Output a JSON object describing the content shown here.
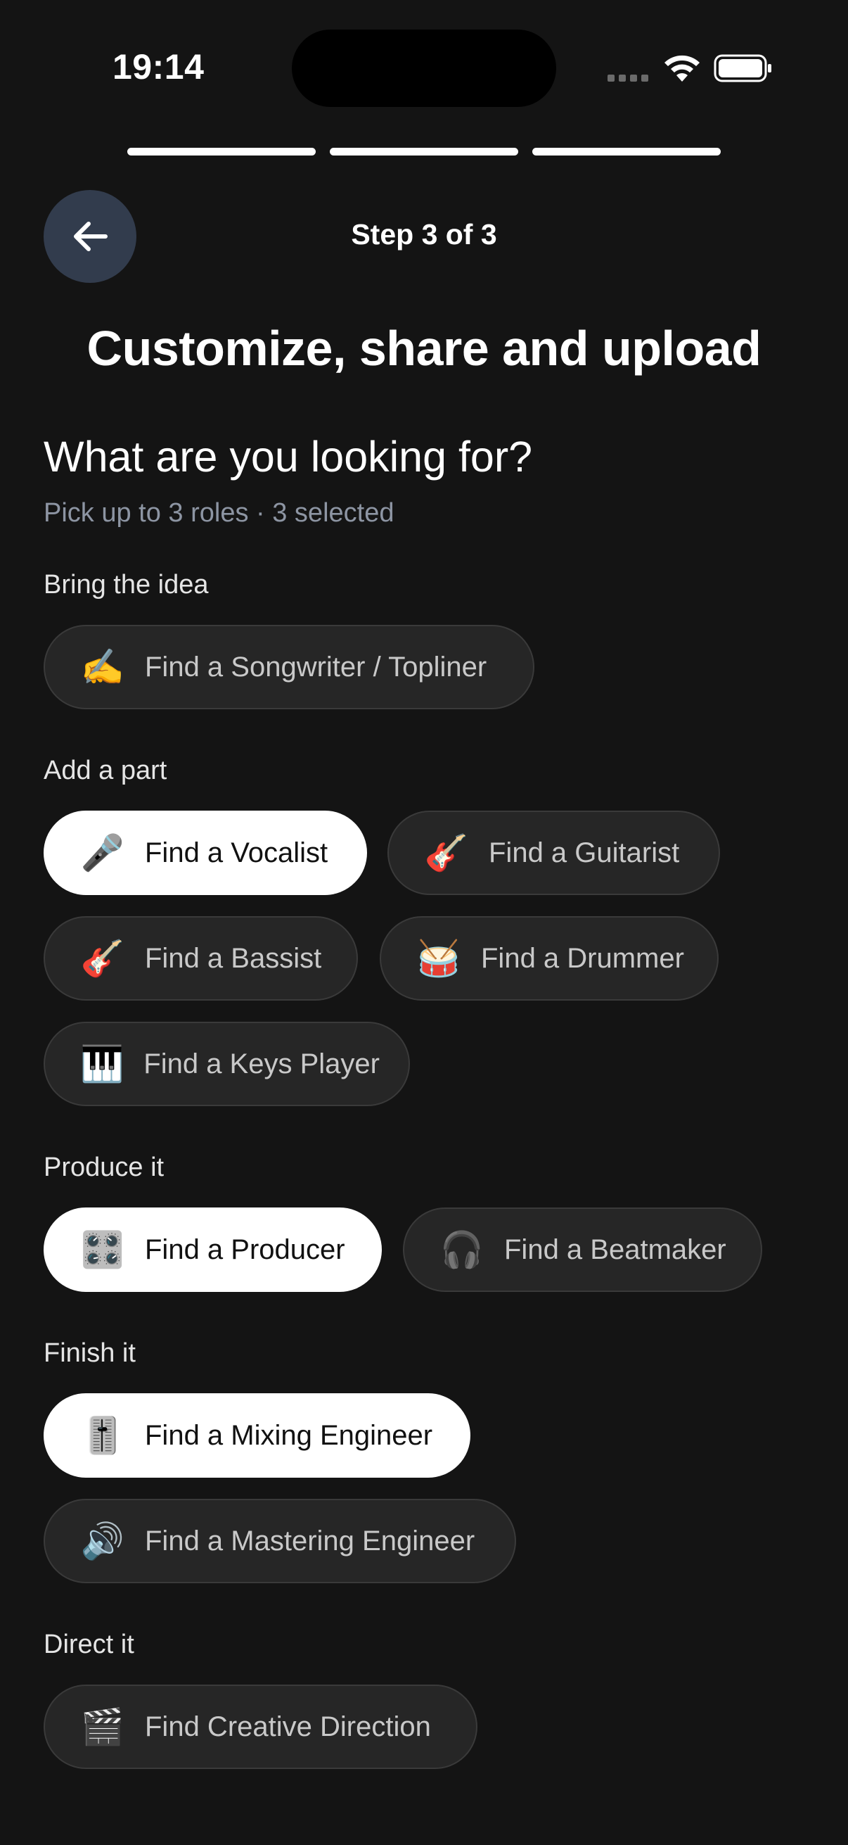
{
  "status": {
    "time": "19:14"
  },
  "progress": {
    "total_steps": 3,
    "completed_steps": 3
  },
  "header": {
    "step_label": "Step 3 of 3",
    "title": "Customize, share and upload"
  },
  "question": {
    "heading": "What are you looking for?",
    "hint": "Pick up to 3 roles · 3 selected"
  },
  "sections": [
    {
      "label": "Bring the idea",
      "roles": [
        {
          "emoji": "✍️",
          "label": "Find a Songwriter / Topliner",
          "selected": false
        }
      ]
    },
    {
      "label": "Add a part",
      "roles": [
        {
          "emoji": "🎤",
          "label": "Find a Vocalist",
          "selected": true
        },
        {
          "emoji": "🎸",
          "label": "Find a Guitarist",
          "selected": false
        },
        {
          "emoji": "🎸",
          "label": "Find a Bassist",
          "selected": false
        },
        {
          "emoji": "🥁",
          "label": "Find a Drummer",
          "selected": false
        },
        {
          "emoji": "🎹",
          "label": "Find a Keys Player",
          "selected": false
        }
      ]
    },
    {
      "label": "Produce it",
      "roles": [
        {
          "emoji": "🎛️",
          "label": "Find a Producer",
          "selected": true
        },
        {
          "emoji": "🎧",
          "label": "Find a Beatmaker",
          "selected": false
        }
      ]
    },
    {
      "label": "Finish it",
      "roles": [
        {
          "emoji": "🎚️",
          "label": "Find a Mixing Engineer",
          "selected": true
        },
        {
          "emoji": "🔊",
          "label": "Find a Mastering Engineer",
          "selected": false
        }
      ]
    },
    {
      "label": "Direct it",
      "roles": [
        {
          "emoji": "🎬",
          "label": "Find Creative Direction",
          "selected": false
        }
      ]
    }
  ]
}
